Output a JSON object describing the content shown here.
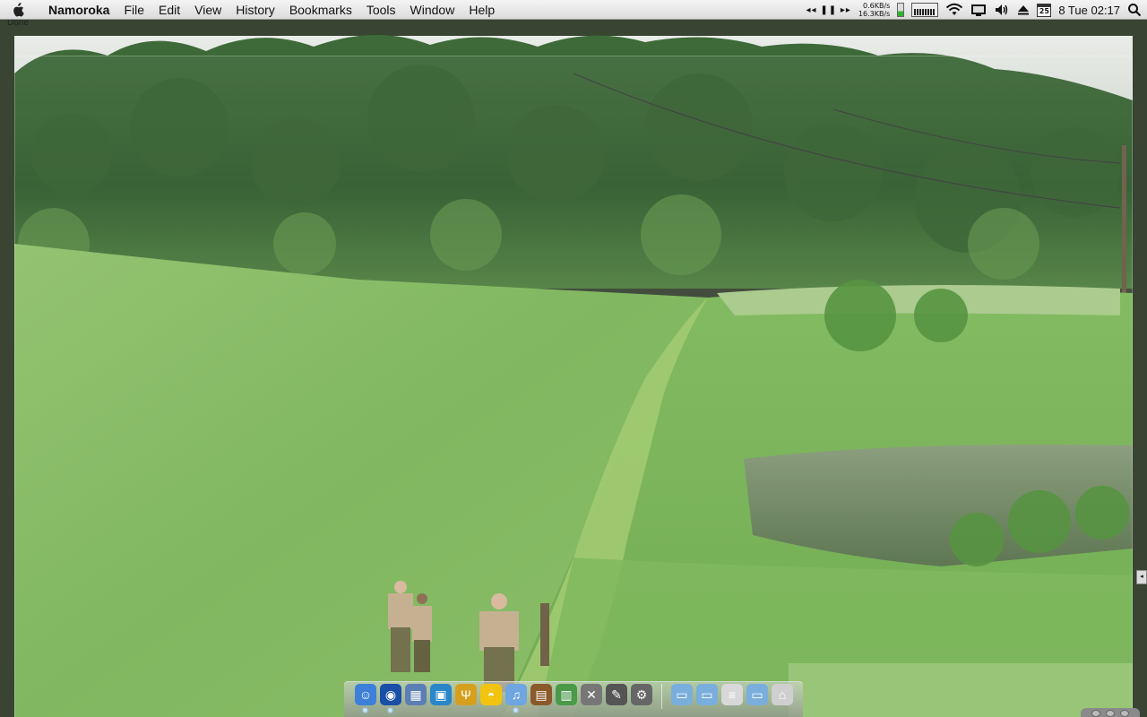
{
  "menubar": {
    "app_name": "Namoroka",
    "items": [
      "File",
      "Edit",
      "View",
      "History",
      "Bookmarks",
      "Tools",
      "Window",
      "Help"
    ],
    "status": {
      "media": "◂◂ ❚❚ ▸▸",
      "net_up": "0.6KB/s",
      "net_down": "16.3KB/s",
      "calendar_day": "25",
      "clock": "8 Tue 02:17"
    }
  },
  "status_line": "Done",
  "dock": {
    "items": [
      {
        "name": "finder-icon",
        "color": "#3d7fd9",
        "glyph": "☺",
        "running": true
      },
      {
        "name": "browser-globe-icon",
        "color": "#1a4fa8",
        "glyph": "◉",
        "running": true
      },
      {
        "name": "preview-icon",
        "color": "#5b7fb5",
        "glyph": "▦",
        "running": false
      },
      {
        "name": "photo-viewer-icon",
        "color": "#2a86c9",
        "glyph": "▣",
        "running": false
      },
      {
        "name": "trident-app-icon",
        "color": "#d6a01e",
        "glyph": "Ψ",
        "running": false
      },
      {
        "name": "rubber-duck-icon",
        "color": "#f2c40f",
        "glyph": "◓",
        "running": false
      },
      {
        "name": "itunes-icon",
        "color": "#6fa5e0",
        "glyph": "♫",
        "running": true
      },
      {
        "name": "photo-booth-icon",
        "color": "#8a5a2a",
        "glyph": "▤",
        "running": false
      },
      {
        "name": "screenshot-app-icon",
        "color": "#4a9a4a",
        "glyph": "▥",
        "running": false
      },
      {
        "name": "utilities-tools-icon",
        "color": "#777777",
        "glyph": "✕",
        "running": false
      },
      {
        "name": "script-editor-icon",
        "color": "#555555",
        "glyph": "✎",
        "running": false
      },
      {
        "name": "system-preferences-icon",
        "color": "#666666",
        "glyph": "⚙",
        "running": false
      }
    ],
    "right_items": [
      {
        "name": "documents-folder-icon",
        "color": "#7aaedc",
        "glyph": "▭"
      },
      {
        "name": "downloads-folder-icon",
        "color": "#7aaedc",
        "glyph": "▭"
      },
      {
        "name": "text-document-icon",
        "color": "#d8d8d8",
        "glyph": "≡"
      },
      {
        "name": "applications-folder-icon",
        "color": "#7aaedc",
        "glyph": "▭"
      },
      {
        "name": "trash-icon",
        "color": "#cfcfcf",
        "glyph": "⌂"
      }
    ]
  }
}
